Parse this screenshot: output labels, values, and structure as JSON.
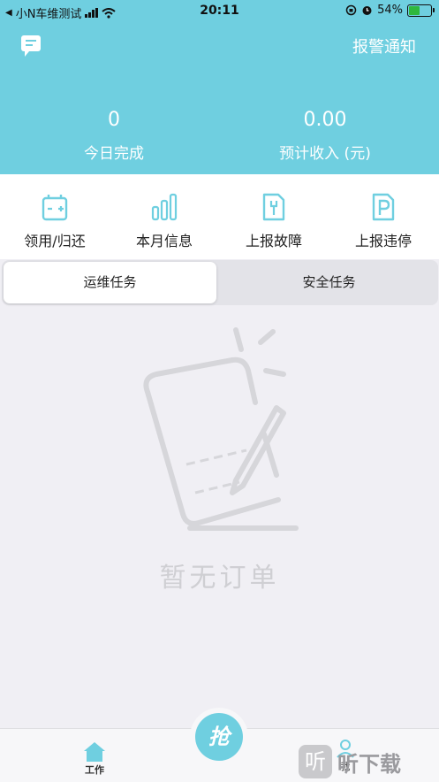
{
  "status_bar": {
    "carrier": "小N车维测试",
    "back_glyph": "◀",
    "time": "20:11",
    "battery_percent": "54%",
    "battery_level": 0.54
  },
  "header": {
    "alarm_label": "报警通知",
    "stats": [
      {
        "value": "0",
        "label": "今日完成"
      },
      {
        "value": "0.00",
        "label": "预计收入 (元)"
      }
    ]
  },
  "actions": [
    {
      "label": "领用/归还",
      "icon": "battery-icon"
    },
    {
      "label": "本月信息",
      "icon": "bar-chart-icon"
    },
    {
      "label": "上报故障",
      "icon": "wrench-doc-icon"
    },
    {
      "label": "上报违停",
      "icon": "parking-icon"
    }
  ],
  "tabs": [
    {
      "label": "运维任务",
      "active": true
    },
    {
      "label": "安全任务",
      "active": false
    }
  ],
  "empty_state": {
    "text": "暂无订单"
  },
  "bottom_nav": {
    "work_label": "工作",
    "grab_label": "抢",
    "me_label": "我"
  },
  "watermark": {
    "logo": "听",
    "text": "听下载"
  },
  "colors": {
    "primary": "#6fcfe0",
    "background": "#f0eff4",
    "illustration": "#d6d6da"
  }
}
